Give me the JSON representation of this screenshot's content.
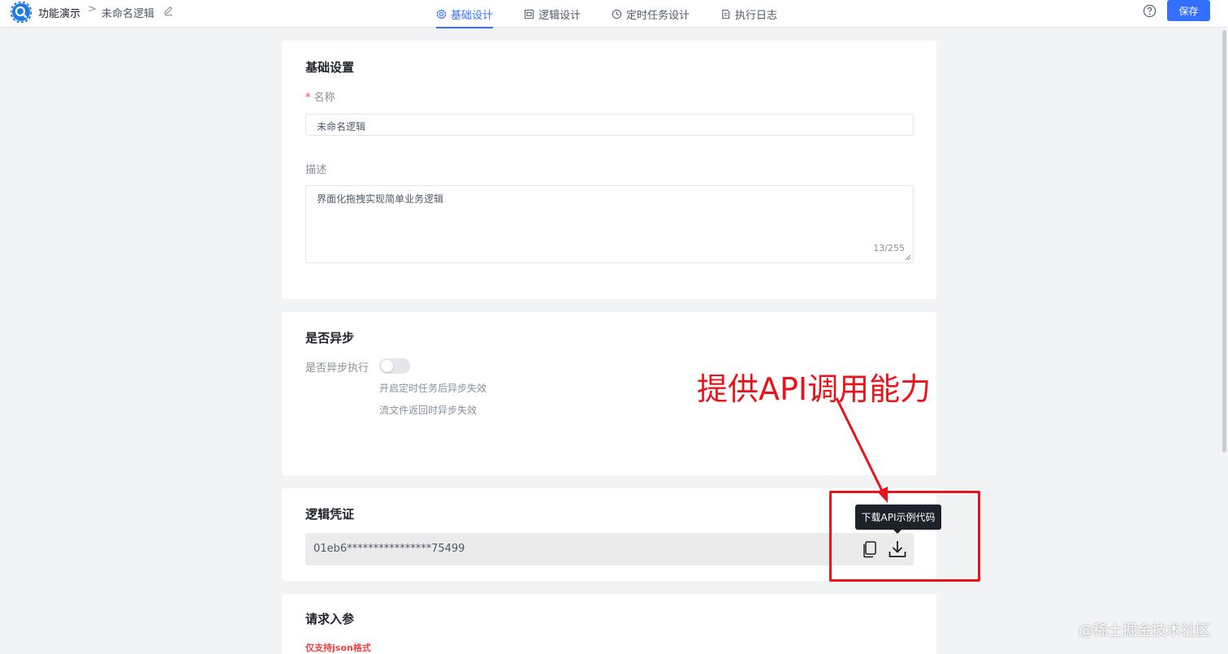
{
  "header": {
    "breadcrumb": {
      "app": "功能演示",
      "separator": ">",
      "name": "未命名逻辑"
    },
    "tabs": [
      {
        "label": "基础设计",
        "icon": "gear-icon",
        "active": true
      },
      {
        "label": "逻辑设计",
        "icon": "logic-icon",
        "active": false
      },
      {
        "label": "定时任务设计",
        "icon": "clock-icon",
        "active": false
      },
      {
        "label": "执行日志",
        "icon": "document-icon",
        "active": false
      }
    ],
    "save_label": "保存"
  },
  "basic": {
    "title": "基础设置",
    "name_label": "名称",
    "required_mark": "*",
    "name_value": "未命名逻辑",
    "desc_label": "描述",
    "desc_value": "界面化拖拽实现简单业务逻辑",
    "desc_counter": "13/255"
  },
  "async": {
    "title": "是否异步",
    "label": "是否异步执行",
    "enabled": false,
    "hint1": "开启定时任务后异步失效",
    "hint2": "流文件返回时异步失效"
  },
  "credential": {
    "title": "逻辑凭证",
    "value": "01eb6****************75499",
    "tooltip": "下载API示例代码"
  },
  "request": {
    "title": "请求入参",
    "note": "仅支持json格式"
  },
  "annotation": {
    "text": "提供API调用能力",
    "color": "#e8141b"
  },
  "watermark": "@稀土掘金技术社区",
  "colors": {
    "accent": "#3370ff",
    "background": "#f2f3f5"
  }
}
